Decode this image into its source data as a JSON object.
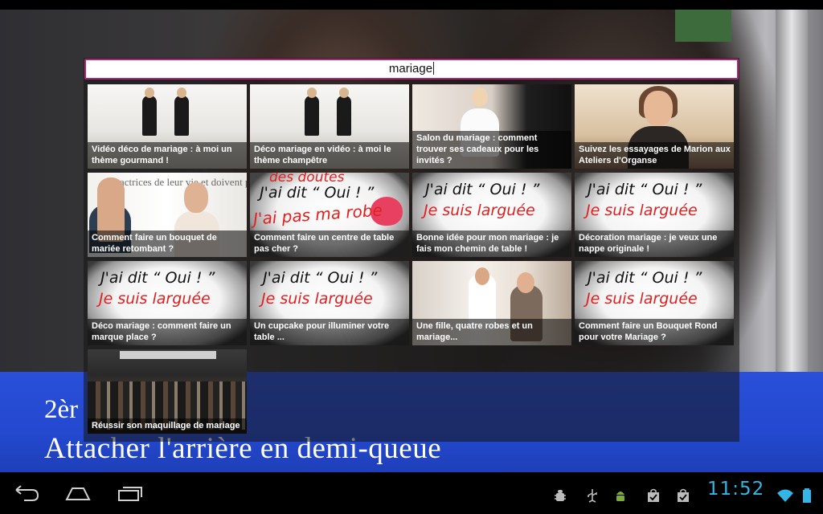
{
  "search": {
    "query": "mariage"
  },
  "video": {
    "subtitle_line1": "2èr",
    "subtitle_line2": "Attacher l'arrière en demi-queue"
  },
  "results": [
    {
      "title": "Vidéo déco de mariage : à moi un thème gourmand !",
      "thumb": "studio"
    },
    {
      "title": "Déco mariage en vidéo : à moi le thème champêtre",
      "thumb": "studio"
    },
    {
      "title": "Salon du mariage : comment trouver ses cadeaux pour les invités ?",
      "thumb": "bride"
    },
    {
      "title": "Suivez les essayages de Marion aux Ateliers d'Organse",
      "thumb": "woman"
    },
    {
      "title": "Comment faire un bouquet de mariée retombant ?",
      "thumb": "duo"
    },
    {
      "title": "Comment faire un centre de table pas cher ?",
      "thumb": "doubts"
    },
    {
      "title": "Bonne idée pour mon mariage : je fais mon chemin de table !",
      "thumb": "card"
    },
    {
      "title": "Décoration mariage : je veux une nappe originale !",
      "thumb": "card"
    },
    {
      "title": "Déco mariage : comment  faire un marque place ?",
      "thumb": "card"
    },
    {
      "title": "Un cupcake pour illuminer votre table ...",
      "thumb": "card"
    },
    {
      "title": "Une fille, quatre robes et un mariage...",
      "thumb": "dresses"
    },
    {
      "title": "Comment faire un Bouquet Rond pour votre Mariage ?",
      "thumb": "card"
    },
    {
      "title": "Réussir son maquillage de mariage",
      "thumb": "fair"
    }
  ],
  "thumb_text": {
    "card_line1": "J'ai dit “ Oui ! ”",
    "card_line2": "Je suis larguée",
    "doubts_top": "des doutes",
    "doubts_line1": "J'ai dit “ Oui ! ”",
    "doubts_line2": "J'ai pas ma robe",
    "duo_text": "actrices de leur vie et doivent prendre en mai"
  },
  "status_bar": {
    "clock": "11:52",
    "icons": [
      "android-debug-icon",
      "usb-icon",
      "android-icon",
      "shopping-bag-icon",
      "shopping-bag-icon",
      "wifi-icon",
      "battery-icon"
    ]
  },
  "colors": {
    "accent": "#33b5e5",
    "search_border": "#b0247a",
    "subtitle_band": "#2449d0"
  }
}
